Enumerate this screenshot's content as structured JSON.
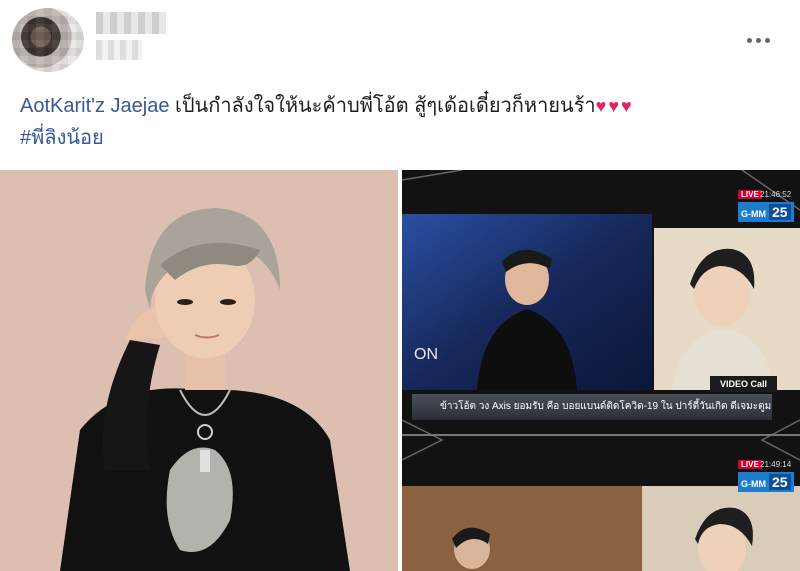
{
  "post": {
    "author": "AotKarit'z Jaejae",
    "body": "เป็นกำลังใจให้นะค้าบพี่โอ้ต สู้ๆเด้อเดี๋ยวก็หายนร้า",
    "hearts": "♥♥♥",
    "hashtag": "#พี่ลิงน้อย",
    "more_icon": "more-horizontal-icon"
  },
  "tv_top": {
    "live_label": "LIVE",
    "time": "21:46:52",
    "channel_logo": "G-MM",
    "channel_number": "25",
    "video_call_label": "VIDEO Call",
    "ticker_text": "ข้าวโอ้ต วง Axis ยอมรับ คือ บอยแบนด์ติดโควิด-19 ใน ปาร์ตี้วันเกิด ดีเจมะตูม"
  },
  "tv_bottom": {
    "live_label": "LIVE",
    "time": "21:49:14",
    "channel_logo": "G-MM",
    "channel_number": "25"
  },
  "colors": {
    "link": "#385898",
    "heart": "#e0245e",
    "live_badge": "#d4002a",
    "channel_logo": "#1e7ccf"
  }
}
